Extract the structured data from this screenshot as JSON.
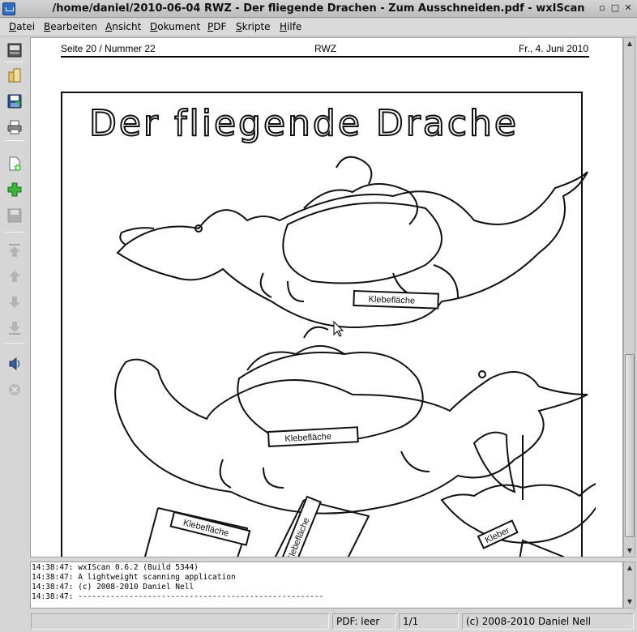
{
  "window": {
    "title": "/home/daniel/2010-06-04 RWZ - Der fliegende Drachen - Zum Ausschneiden.pdf - wxIScan",
    "buttons": {
      "minimize": "▫",
      "maximize": "□",
      "close": "✕"
    }
  },
  "menubar": {
    "items": [
      "Datei",
      "Bearbeiten",
      "Ansicht",
      "Dokument",
      "PDF",
      "Skripte",
      "Hilfe"
    ]
  },
  "toolbar": {
    "tools": [
      {
        "name": "scan-icon",
        "enabled": true
      },
      {
        "name": "open-icon",
        "enabled": true
      },
      {
        "name": "save-icon",
        "enabled": true
      },
      {
        "name": "print-icon",
        "enabled": true
      },
      {
        "name": "new-page-icon",
        "enabled": true
      },
      {
        "name": "add-icon",
        "enabled": true
      },
      {
        "name": "save-disabled-icon",
        "enabled": false
      },
      {
        "name": "move-top-icon",
        "enabled": false
      },
      {
        "name": "move-up-icon",
        "enabled": false
      },
      {
        "name": "move-down-icon",
        "enabled": false
      },
      {
        "name": "move-bottom-icon",
        "enabled": false
      },
      {
        "name": "speaker-icon",
        "enabled": true
      },
      {
        "name": "cancel-icon",
        "enabled": false
      }
    ]
  },
  "document": {
    "header_left": "Seite 20 / Nummer 22",
    "header_center": "RWZ",
    "header_right": "Fr., 4. Juni 2010",
    "art_title": "Der fliegende Drache",
    "labels": [
      "Klebefläche",
      "Klebefläche",
      "Klebefläche",
      "Klebefläche",
      "Kleber"
    ]
  },
  "log": {
    "lines": [
      "14:38:47: wxIScan 0.6.2 (Build 5344)",
      "14:38:47: A lightweight scanning application",
      "14:38:47: (c) 2008-2010 Daniel Nell",
      "14:38:47: -----------------------------------------------------"
    ]
  },
  "statusbar": {
    "main": "",
    "pdf": "PDF: leer",
    "page": "1/1",
    "copyright": "(c) 2008-2010 Daniel Nell"
  }
}
